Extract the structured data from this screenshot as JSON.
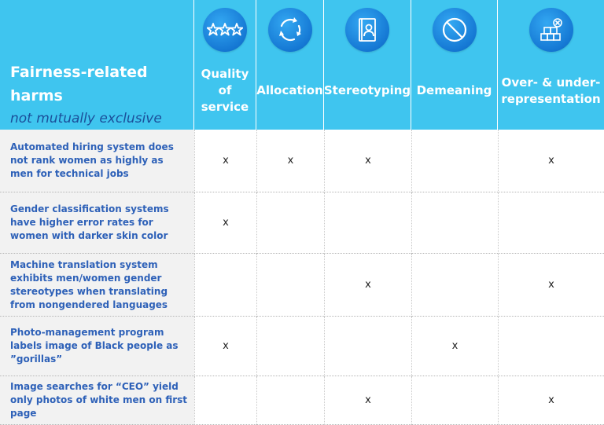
{
  "title": "Fairness-related harms",
  "subtitle": "not mutually exclusive",
  "columns": [
    {
      "label": "Quality of service",
      "icon": "stars-icon"
    },
    {
      "label": "Allocation",
      "icon": "cycle-arrows-icon"
    },
    {
      "label": "Stereotyping",
      "icon": "person-document-icon"
    },
    {
      "label": "Demeaning",
      "icon": "prohibited-icon"
    },
    {
      "label": "Over- & under-representation",
      "icon": "blocks-icon"
    }
  ],
  "rows": [
    {
      "label": "Automated hiring system does not rank women as highly as men for technical jobs",
      "marks": [
        "x",
        "x",
        "x",
        "",
        "x"
      ]
    },
    {
      "label": "Gender classification systems have higher error rates for women with darker skin color",
      "marks": [
        "x",
        "",
        "",
        "",
        ""
      ]
    },
    {
      "label": "Machine translation system exhibits men/women gender stereotypes when translating from nongendered languages",
      "marks": [
        "",
        "",
        "x",
        "",
        "x"
      ]
    },
    {
      "label": "Photo-management program labels image of Black people as ”gorillas”",
      "marks": [
        "x",
        "",
        "",
        "x",
        ""
      ]
    },
    {
      "label": "Image searches for “CEO” yield only photos of white men on first page",
      "marks": [
        "",
        "",
        "x",
        "",
        "x"
      ]
    }
  ],
  "colors": {
    "header_bg": "#3fc5ef",
    "icon_bg": "#1578d4",
    "subtitle": "#1b4f9a",
    "row_label": "#2e61b8",
    "row_label_bg": "#f2f2f2"
  }
}
